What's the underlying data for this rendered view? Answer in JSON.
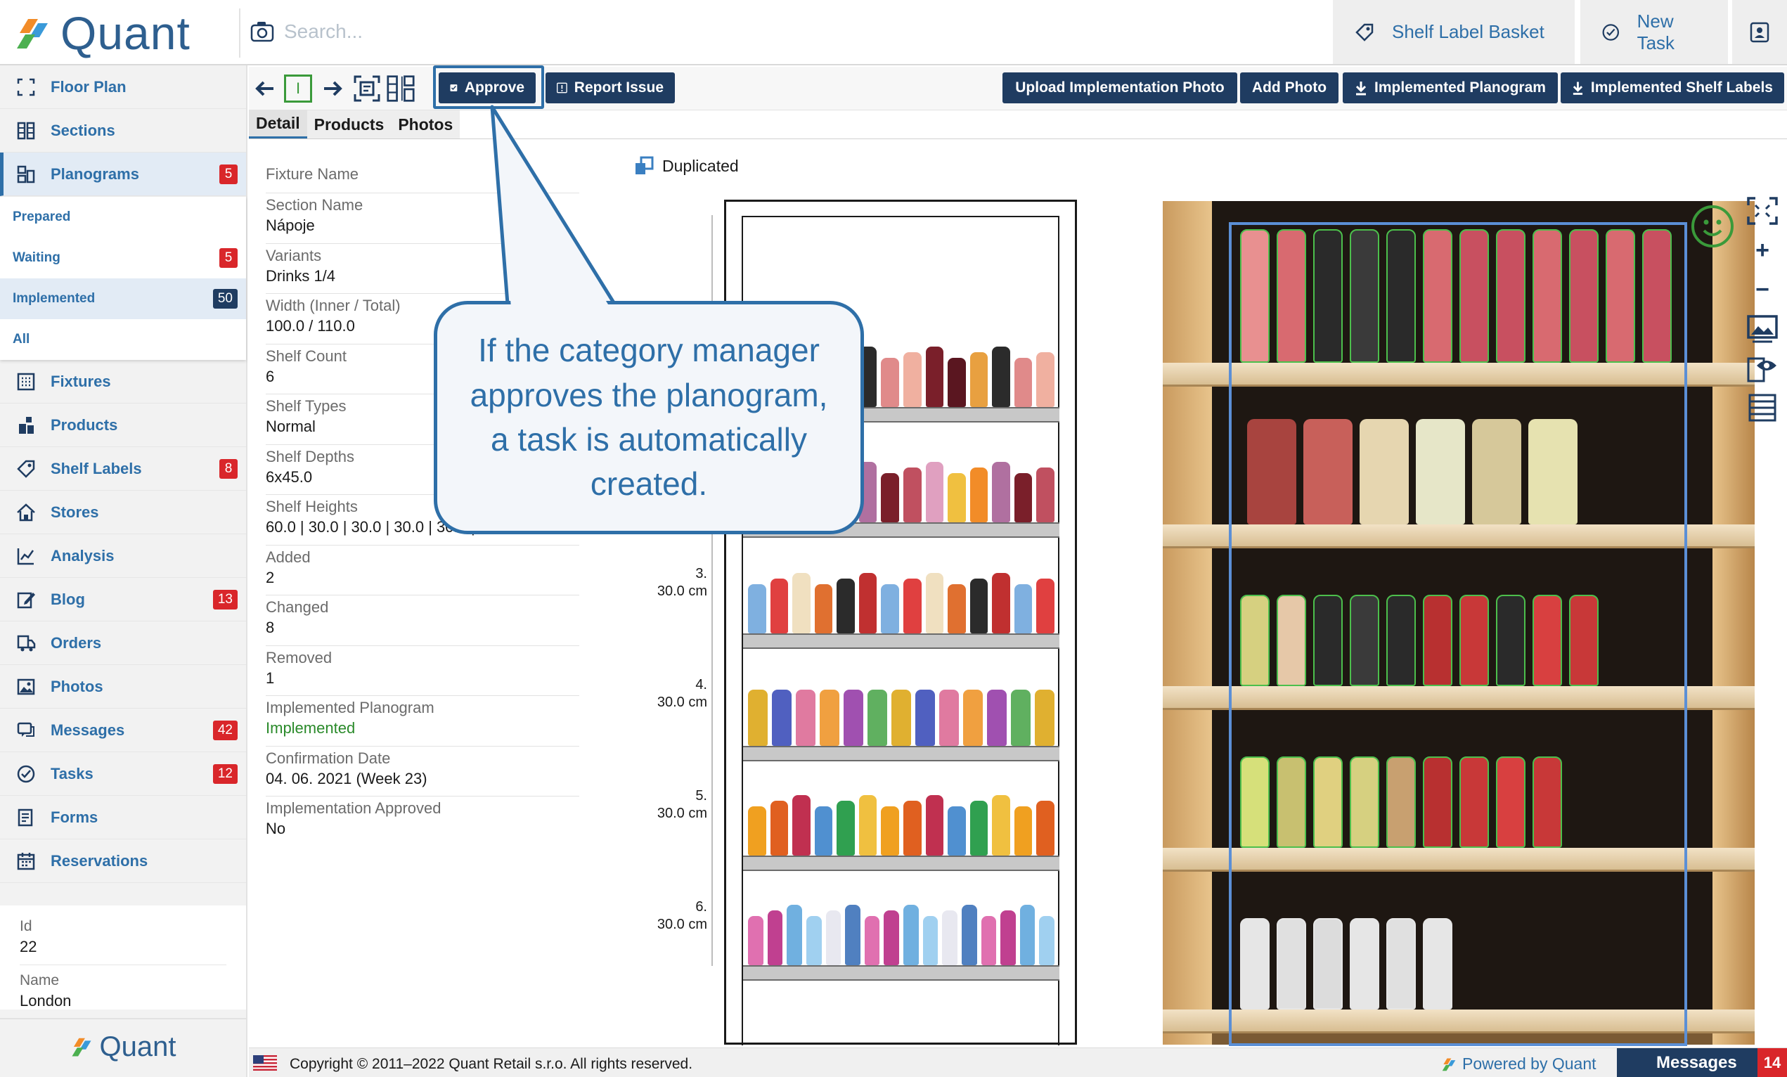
{
  "app": {
    "brand": "Quant"
  },
  "search": {
    "placeholder": "Search..."
  },
  "header": {
    "shelf_label_basket": "Shelf Label Basket",
    "new_task": "New Task"
  },
  "sidebar": {
    "items": [
      {
        "label": "Floor Plan",
        "icon": "floor-plan-icon"
      },
      {
        "label": "Sections",
        "icon": "sections-icon"
      },
      {
        "label": "Planograms",
        "icon": "planograms-icon",
        "badge": "5"
      },
      {
        "label": "Fixtures",
        "icon": "fixtures-icon"
      },
      {
        "label": "Products",
        "icon": "products-icon"
      },
      {
        "label": "Shelf Labels",
        "icon": "tag-icon",
        "badge": "8"
      },
      {
        "label": "Stores",
        "icon": "store-icon"
      },
      {
        "label": "Analysis",
        "icon": "chart-icon"
      },
      {
        "label": "Blog",
        "icon": "edit-icon",
        "badge": "13"
      },
      {
        "label": "Orders",
        "icon": "truck-icon"
      },
      {
        "label": "Photos",
        "icon": "photo-icon"
      },
      {
        "label": "Messages",
        "icon": "chat-icon",
        "badge": "42"
      },
      {
        "label": "Tasks",
        "icon": "check-circle-icon",
        "badge": "12"
      },
      {
        "label": "Forms",
        "icon": "form-icon"
      },
      {
        "label": "Reservations",
        "icon": "calendar-icon"
      }
    ],
    "sub_items": [
      {
        "label": "Prepared"
      },
      {
        "label": "Waiting",
        "badge": "5"
      },
      {
        "label": "Implemented",
        "badge": "50"
      },
      {
        "label": "All"
      }
    ],
    "store": {
      "id_label": "Id",
      "id_value": "22",
      "name_label": "Name",
      "name_value": "London"
    }
  },
  "toolbar": {
    "indicator": "I",
    "approve": "Approve",
    "report_issue": "Report Issue",
    "upload_photo": "Upload Implementation Photo",
    "add_photo": "Add Photo",
    "implemented_planogram": "Implemented Planogram",
    "implemented_shelf_labels": "Implemented Shelf Labels"
  },
  "tabs": [
    "Detail",
    "Products",
    "Photos"
  ],
  "detail": {
    "fixture_name_label": "Fixture Name",
    "rows": [
      {
        "label": "Section Name",
        "value": "Nápoje"
      },
      {
        "label": "Variants",
        "value": "Drinks 1/4"
      },
      {
        "label": "Width (Inner / Total)",
        "value": "100.0 / 110.0"
      },
      {
        "label": "Shelf Count",
        "value": "6"
      },
      {
        "label": "Shelf Types",
        "value": "Normal"
      },
      {
        "label": "Shelf Depths",
        "value": "6x45.0"
      },
      {
        "label": "Shelf Heights",
        "value": "60.0 | 30.0 | 30.0 | 30.0 | 30.0 | 30.0"
      },
      {
        "label": "Added",
        "value": "2"
      },
      {
        "label": "Changed",
        "value": "8"
      },
      {
        "label": "Removed",
        "value": "1"
      },
      {
        "label": "Implemented Planogram",
        "value": "Implemented"
      },
      {
        "label": "Confirmation Date",
        "value": "04. 06. 2021 (Week 23)"
      },
      {
        "label": "Implementation Approved",
        "value": "No"
      }
    ]
  },
  "planogram": {
    "duplicated": "Duplicated",
    "shelves": [
      {
        "index": "3.",
        "height": "30.0 cm"
      },
      {
        "index": "4.",
        "height": "30.0 cm"
      },
      {
        "index": "5.",
        "height": "30.0 cm"
      },
      {
        "index": "6.",
        "height": "30.0 cm"
      }
    ]
  },
  "callout": {
    "text": "If the category manager approves the planogram, a task is automatically created."
  },
  "footer": {
    "copyright": "Copyright © 2011–2022 Quant Retail s.r.o. All rights reserved.",
    "powered": "Powered by Quant",
    "messages": "Messages",
    "messages_count": "14"
  },
  "colors": {
    "primary": "#1f3c61",
    "link": "#2e6fa8",
    "badge": "#d9262a",
    "success": "#2a8a2a"
  }
}
